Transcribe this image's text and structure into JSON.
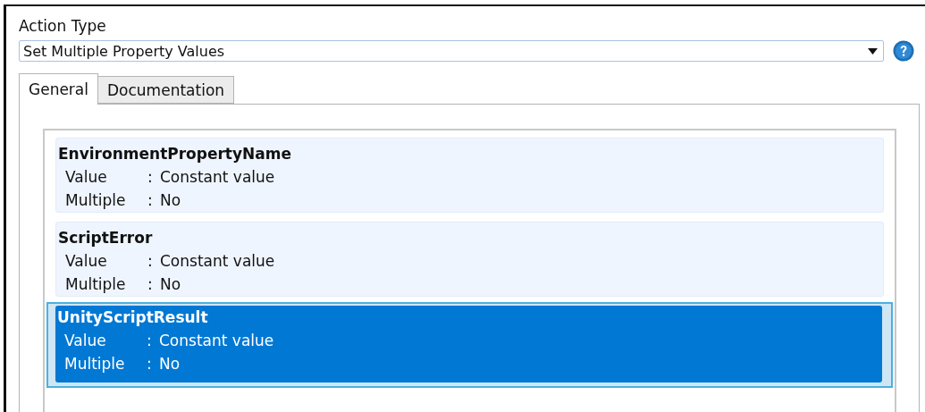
{
  "action_type": {
    "label": "Action Type",
    "value": "Set Multiple Property Values"
  },
  "tabs": [
    {
      "label": "General",
      "selected": true
    },
    {
      "label": "Documentation",
      "selected": false
    }
  ],
  "properties": [
    {
      "name": "EnvironmentPropertyName",
      "selected": false,
      "fields": [
        {
          "key": "Value",
          "separator": ":",
          "value": "Constant value"
        },
        {
          "key": "Multiple",
          "separator": ":",
          "value": "No"
        }
      ]
    },
    {
      "name": "ScriptError",
      "selected": false,
      "fields": [
        {
          "key": "Value",
          "separator": ":",
          "value": "Constant value"
        },
        {
          "key": "Multiple",
          "separator": ":",
          "value": "No"
        }
      ]
    },
    {
      "name": "UnityScriptResult",
      "selected": true,
      "fields": [
        {
          "key": "Value",
          "separator": ":",
          "value": "Constant value"
        },
        {
          "key": "Multiple",
          "separator": ":",
          "value": "No"
        }
      ]
    }
  ]
}
